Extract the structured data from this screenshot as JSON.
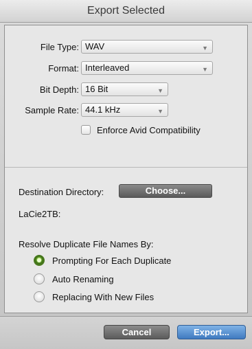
{
  "window": {
    "title": "Export Selected"
  },
  "settings": {
    "file_type": {
      "label": "File Type:",
      "value": "WAV"
    },
    "format": {
      "label": "Format:",
      "value": "Interleaved"
    },
    "bit_depth": {
      "label": "Bit Depth:",
      "value": "16 Bit"
    },
    "sample_rate": {
      "label": "Sample Rate:",
      "value": "44.1 kHz"
    },
    "enforce_avid": {
      "label": "Enforce Avid Compatibility",
      "checked": false
    }
  },
  "destination": {
    "label": "Destination Directory:",
    "choose_label": "Choose...",
    "path": "LaCie2TB:"
  },
  "resolve": {
    "label": "Resolve Duplicate File Names By:",
    "options": [
      {
        "label": "Prompting For Each Duplicate",
        "selected": true
      },
      {
        "label": "Auto Renaming",
        "selected": false
      },
      {
        "label": "Replacing With New Files",
        "selected": false
      }
    ]
  },
  "buttons": {
    "cancel": "Cancel",
    "export": "Export..."
  },
  "icons": {
    "dropdown": "chevron-down-icon"
  },
  "colors": {
    "selected_radio": "#5f9a2a",
    "primary_button": "#3f7ac0"
  }
}
